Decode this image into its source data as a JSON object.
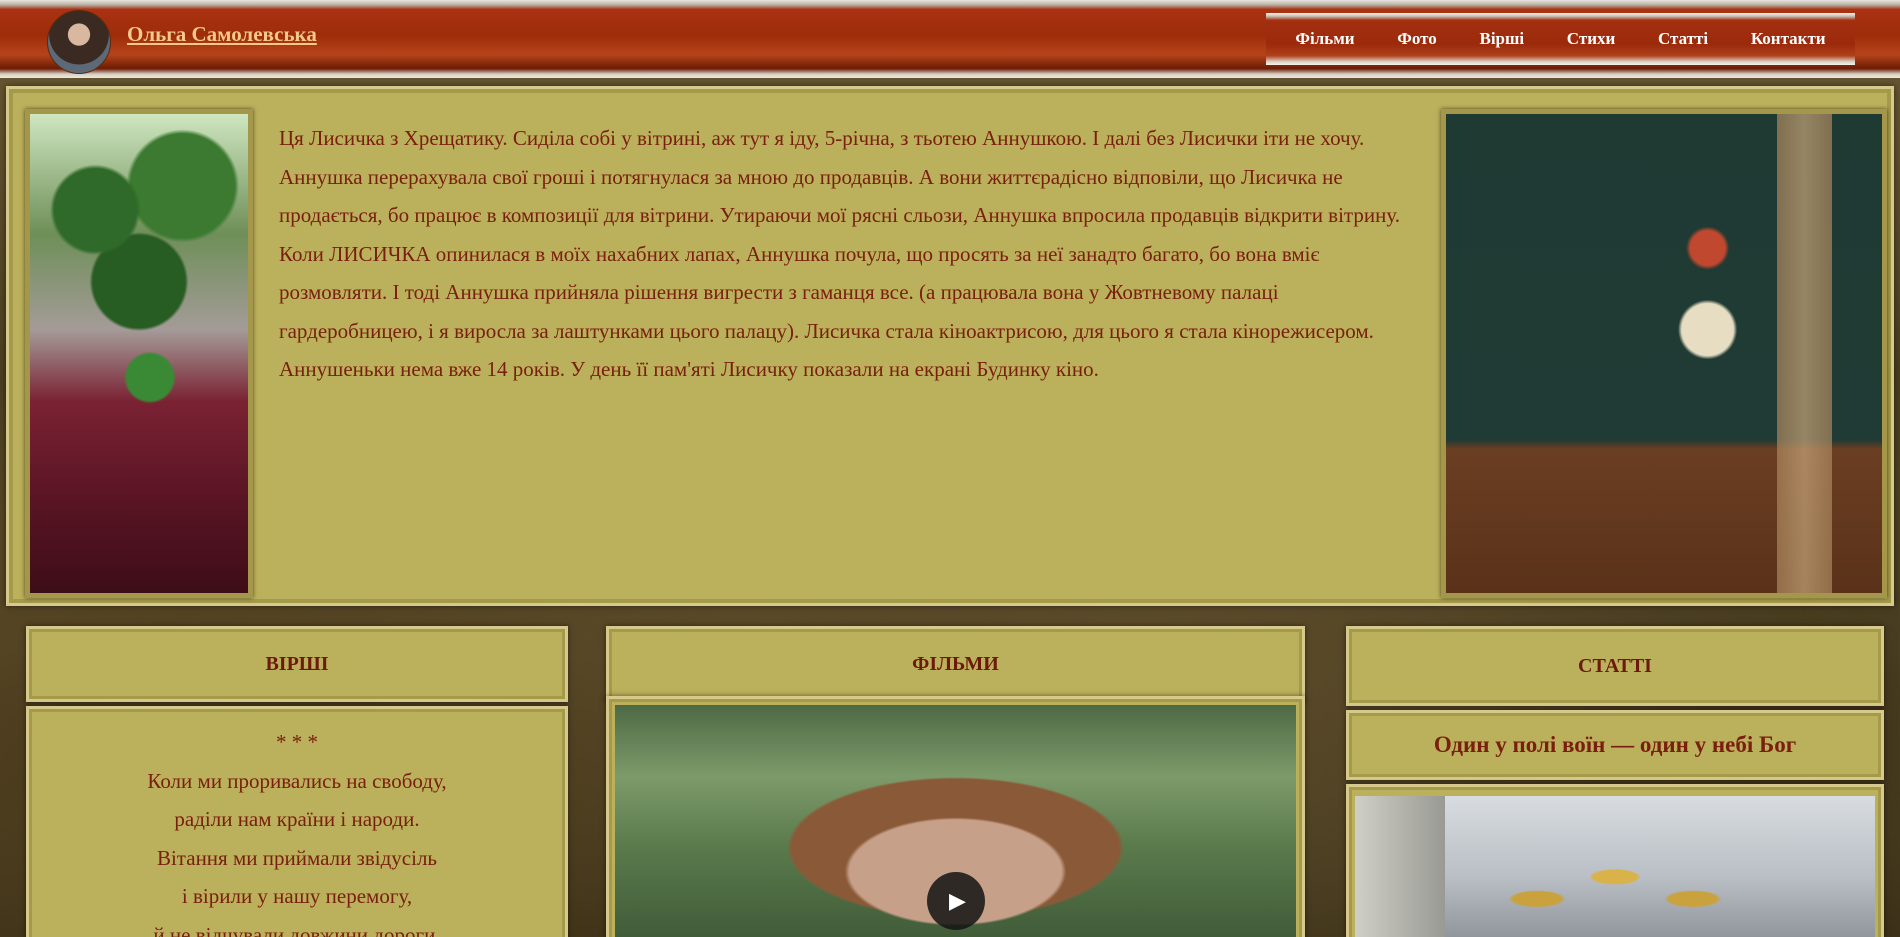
{
  "header": {
    "site_title": "Ольга Самолевська",
    "nav": [
      "Фільми",
      "Фото",
      "Вірші",
      "Стихи",
      "Статті",
      "Контакти"
    ]
  },
  "intro": {
    "text": "Ця Лисичка з Хрещатику. Сиділа собі у вітрині, аж тут я іду, 5-річна, з тьотею Аннушкою. І далі без Лисички іти не хочу. Аннушка перерахувала свої гроші і потягнулася за мною до продавців. А вони життєрадісно відповіли, що Лисичка не продається, бо працює в композиції для вітрини. Утираючи мої рясні сльози, Аннушка впросила продавців відкрити вітрину. Коли ЛИСИЧКА опинилася в моїх нахабних лапах, Аннушка почула, що просять за неї занадто багато, бо вона вміє розмовляти. І тоді Аннушка прийняла рішення вигрести з гаманця все. (а працювала вона у Жовтневому палаці гардеробницею, і я виросла за лаштунками цього палацу). Лисичка стала кіноактрисою, для цього я стала кінорежисером. Аннушеньки нема вже 14 років. У день її пам'яті Лисичку показали на екрані Будинку кіно."
  },
  "poems": {
    "heading": "ВІРШІ",
    "lines": [
      "* * *",
      "Коли ми проривались на свободу,",
      "раділи нам країни і народи.",
      "Вітання ми приймали звідусіль",
      "і вірили у нашу перемогу,",
      "й не відчували довжини дороги."
    ]
  },
  "films": {
    "heading": "ФІЛЬМИ",
    "play_icon": "▶"
  },
  "articles": {
    "heading": "СТАТТІ",
    "title": "Один у полі воїн — один у небі Бог"
  }
}
